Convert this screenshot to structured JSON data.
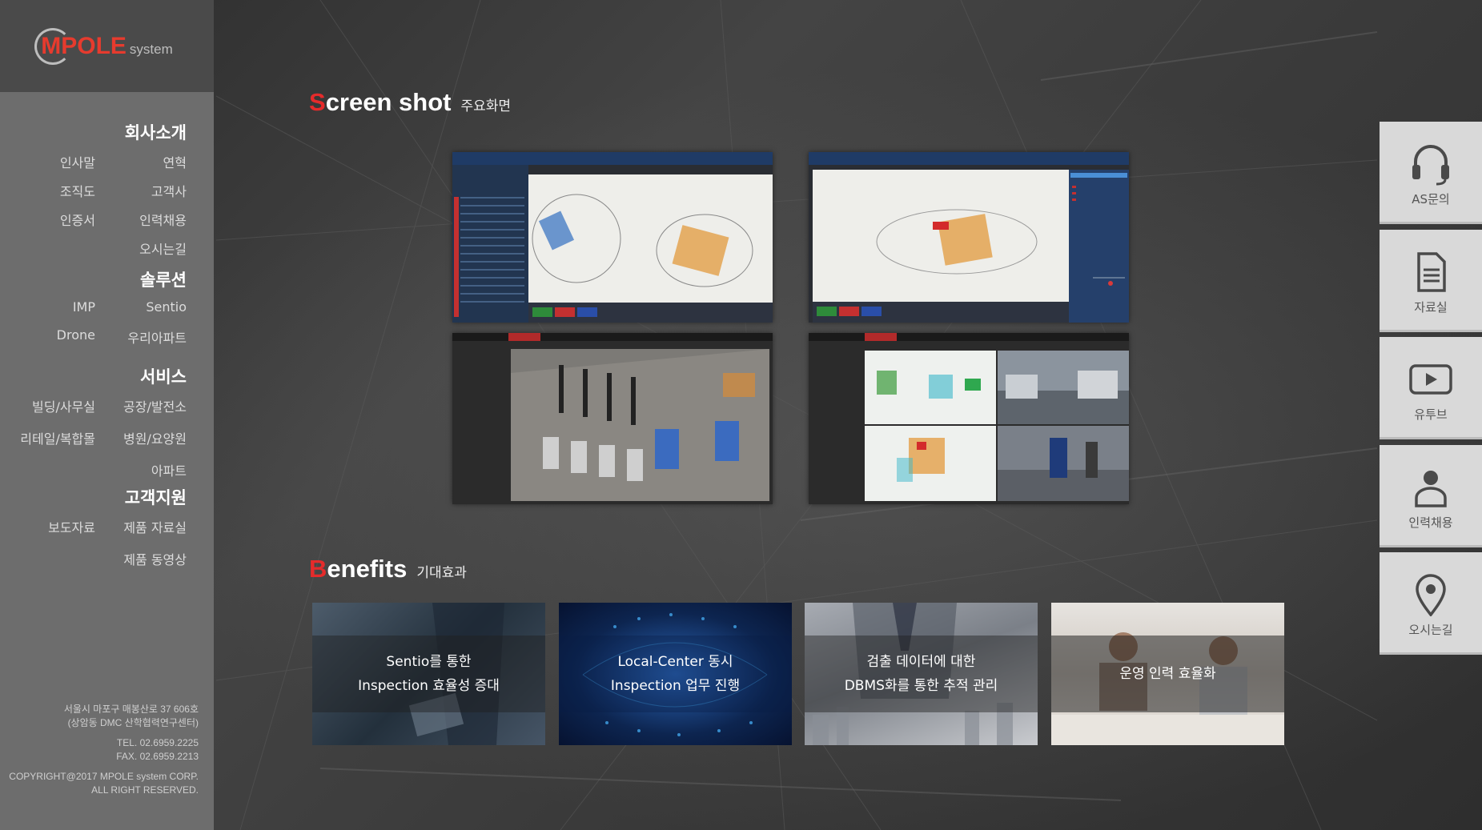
{
  "logo": {
    "main": "MPOLE",
    "sub": "system"
  },
  "nav": [
    {
      "title": "회사소개",
      "rows": [
        [
          "인사말",
          "연혁"
        ],
        [
          "조직도",
          "고객사"
        ],
        [
          "인증서",
          "인력채용"
        ],
        [
          "",
          "오시는길"
        ]
      ]
    },
    {
      "title": "솔루션",
      "rows": [
        [
          "IMP",
          "Sentio"
        ],
        [
          "Drone",
          "우리아파트"
        ]
      ]
    },
    {
      "title": "서비스",
      "rows": [
        [
          "빌딩/사무실",
          "공장/발전소"
        ],
        [
          "리테일/복합몰",
          "병원/요양원"
        ],
        [
          "",
          "아파트"
        ]
      ]
    },
    {
      "title": "고객지원",
      "rows": [
        [
          "보도자료",
          "제품 자료실"
        ],
        [
          "",
          "제품 동영상"
        ]
      ]
    }
  ],
  "footer": {
    "address1": "서울시 마포구 매봉산로 37 606호",
    "address2": "(상암동 DMC 산학협력연구센터)",
    "tel": "TEL. 02.6959.2225",
    "fax": "FAX. 02.6959.2213",
    "copyright1": "COPYRIGHT@2017 MPOLE system CORP.",
    "copyright2": "ALL RIGHT RESERVED."
  },
  "screenshot_section": {
    "first_letter": "S",
    "title_rest": "creen shot",
    "subtitle": "주요화면"
  },
  "benefits_section": {
    "first_letter": "B",
    "title_rest": "enefits",
    "subtitle": "기대효과"
  },
  "benefits": [
    {
      "line1": "Sentio를 통한",
      "line2": "Inspection 효율성 증대"
    },
    {
      "line1": "Local-Center 동시",
      "line2": "Inspection 업무 진행"
    },
    {
      "line1": "검출 데이터에 대한",
      "line2": "DBMS화를 통한 추적 관리"
    },
    {
      "line1": "운영 인력 효율화",
      "line2": ""
    }
  ],
  "quick_menu": [
    {
      "label": "AS문의",
      "icon": "headset-icon"
    },
    {
      "label": "자료실",
      "icon": "document-icon"
    },
    {
      "label": "유투브",
      "icon": "play-icon"
    },
    {
      "label": "인력채용",
      "icon": "person-icon"
    },
    {
      "label": "오시는길",
      "icon": "location-pin-icon"
    }
  ],
  "colors": {
    "accent_red": "#e52b2b",
    "sidebar": "#6d6d6d",
    "quick_menu_bg": "#d9d9d9"
  }
}
